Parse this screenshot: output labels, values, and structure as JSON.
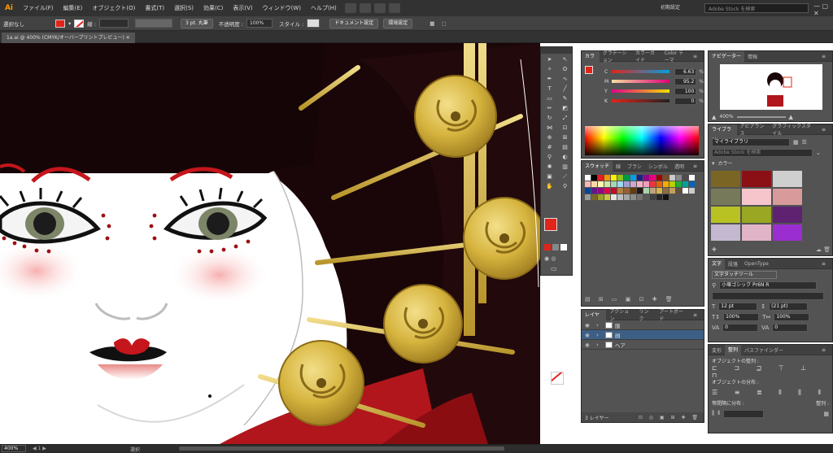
{
  "app": {
    "logo": "Ai"
  },
  "menubar": {
    "items": [
      "ファイル(F)",
      "編集(E)",
      "オブジェクト(O)",
      "書式(T)",
      "選択(S)",
      "効果(C)",
      "表示(V)",
      "ウィンドウ(W)",
      "ヘルプ(H)"
    ],
    "workspace": "初期設定",
    "stock_placeholder": "Adobe Stock を検索"
  },
  "controlbar": {
    "selection": "選択なし",
    "stroke_label": "線 :",
    "brush": "3 pt. 丸筆",
    "opacity_label": "不透明度 :",
    "opacity": "100%",
    "style_label": "スタイル :",
    "doc_settings": "ドキュメント設定",
    "prefs": "環境設定"
  },
  "doctab": {
    "title": "1a.ai @ 400% (CMYK/オーバープリントプレビュー)"
  },
  "status": {
    "zoom": "400%",
    "tool": "選択"
  },
  "color_panel": {
    "tabs": [
      "カラー",
      "グラデーション",
      "カラーガイド",
      "Color テーマ"
    ],
    "channels": [
      {
        "k": "C",
        "v": "6.63",
        "u": "%",
        "c": "#00a0e0"
      },
      {
        "k": "M",
        "v": "95.2",
        "u": "%",
        "c": "#e0007a"
      },
      {
        "k": "Y",
        "v": "100",
        "u": "%",
        "c": "#f0e000"
      },
      {
        "k": "K",
        "v": "0",
        "u": "%",
        "c": "#444444"
      }
    ]
  },
  "swatch_panel": {
    "tabs": [
      "スウォッチ",
      "線",
      "ブラシ",
      "シンボル",
      "透明"
    ],
    "colors": [
      "#ffffff",
      "#000000",
      "#e31e24",
      "#f39800",
      "#fff100",
      "#8fc31f",
      "#009944",
      "#00a0e9",
      "#1d2088",
      "#920783",
      "#e4007f",
      "#a40000",
      "#7d4e24",
      "#c9caca",
      "#898989",
      "#4c4c4c",
      "#ffffff",
      "#f8b6b0",
      "#fcd8a8",
      "#fff8b0",
      "#d0e6a5",
      "#a3d6b4",
      "#a0d8ef",
      "#a0a0d0",
      "#cfa7cd",
      "#f5b2c6",
      "#f19ec2",
      "#e8383d",
      "#eb6100",
      "#f6ab00",
      "#b8d200",
      "#22ac38",
      "#00a199",
      "#0068b7",
      "#00479d",
      "#601986",
      "#920783",
      "#e5004f",
      "#c30d23",
      "#b28146",
      "#956134",
      "#6a3906",
      "#231815",
      "#a5d4ad",
      "#bfa27e",
      "#d7b447",
      "#8c6d3f",
      "#c0a060",
      "#605040",
      "#ffffff",
      "#cccccc",
      "#999999",
      "#7a6a2a",
      "#9aa12a",
      "#c8c840",
      "#e6e6e6",
      "#bfbfbf",
      "#a6a6a6",
      "#8c8c8c",
      "#737373",
      "#595959",
      "#404040",
      "#262626",
      "#131313"
    ]
  },
  "layers_panel": {
    "tabs": [
      "レイヤー",
      "アクション",
      "リンク",
      "アートボード"
    ],
    "layers": [
      {
        "name": "服",
        "selected": false
      },
      {
        "name": "顔",
        "selected": true
      },
      {
        "name": "ヘア",
        "selected": false
      }
    ],
    "count": "3 レイヤー"
  },
  "navigator": {
    "tabs": [
      "ナビゲーター",
      "情報"
    ],
    "zoom": "400%"
  },
  "library_panel": {
    "tabs": [
      "ライブラリ",
      "アピアランス",
      "グラフィックスタイル"
    ],
    "library": "マイライブラリ",
    "search_placeholder": "Adobe Stock を検索",
    "section": "カラー",
    "colors": [
      "#7a6524",
      "#8b1015",
      "#cfcfcf",
      "#777a5a",
      "#f6c5cc",
      "#d89a9a",
      "#b8c222",
      "#9aa722",
      "#5e2270",
      "#c4b8d0",
      "#e1b4c7",
      "#9a2ed0"
    ]
  },
  "char_panel": {
    "tabs": [
      "文字",
      "段落",
      "OpenType"
    ],
    "touch_tool": "文字タッチツール",
    "font": "小塚ゴシック Pr6N R",
    "size": "12 pt",
    "leading": "(21 pt)",
    "hscale": "100%",
    "vscale": "100%",
    "track": "0",
    "kern": "0"
  },
  "align_panel": {
    "tabs": [
      "変形",
      "整列",
      "パスファインダー"
    ],
    "align_objects": "オブジェクトの整列 :",
    "distribute_objects": "オブジェクトの分布 :",
    "distribute_spacing": "等間隔に分布 :",
    "align_to": "整列 :"
  }
}
